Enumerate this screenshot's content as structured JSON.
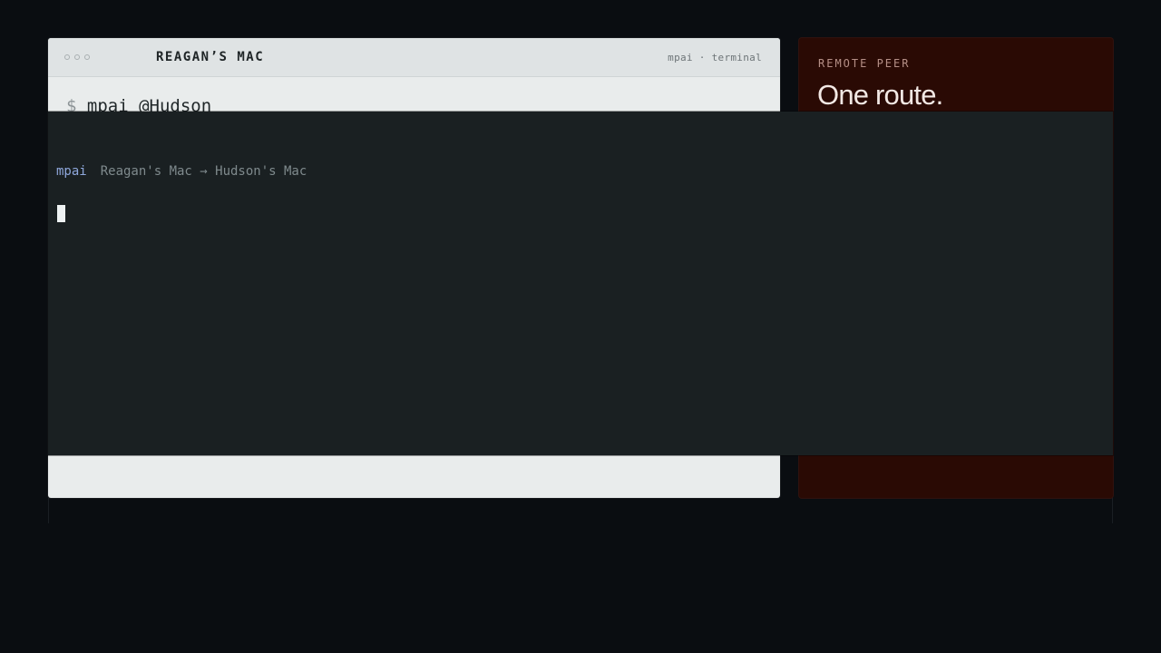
{
  "terminal_window": {
    "title": "REAGAN’S MAC",
    "meta": "mpai · terminal",
    "prompt": "$",
    "command": "mpai @Hudson"
  },
  "remote_peer": {
    "eyebrow": "REMOTE PEER",
    "heading": "One route."
  },
  "overlay": {
    "app_name": "mpai",
    "route": "Reagan's Mac → Hudson's Mac"
  },
  "colors": {
    "page_bg": "#0a0d11",
    "terminal_bg": "#e9ecec",
    "peer_bg": "#2a0a04",
    "overlay_bg": "#1a2022",
    "app_accent": "#8fa8dc"
  }
}
